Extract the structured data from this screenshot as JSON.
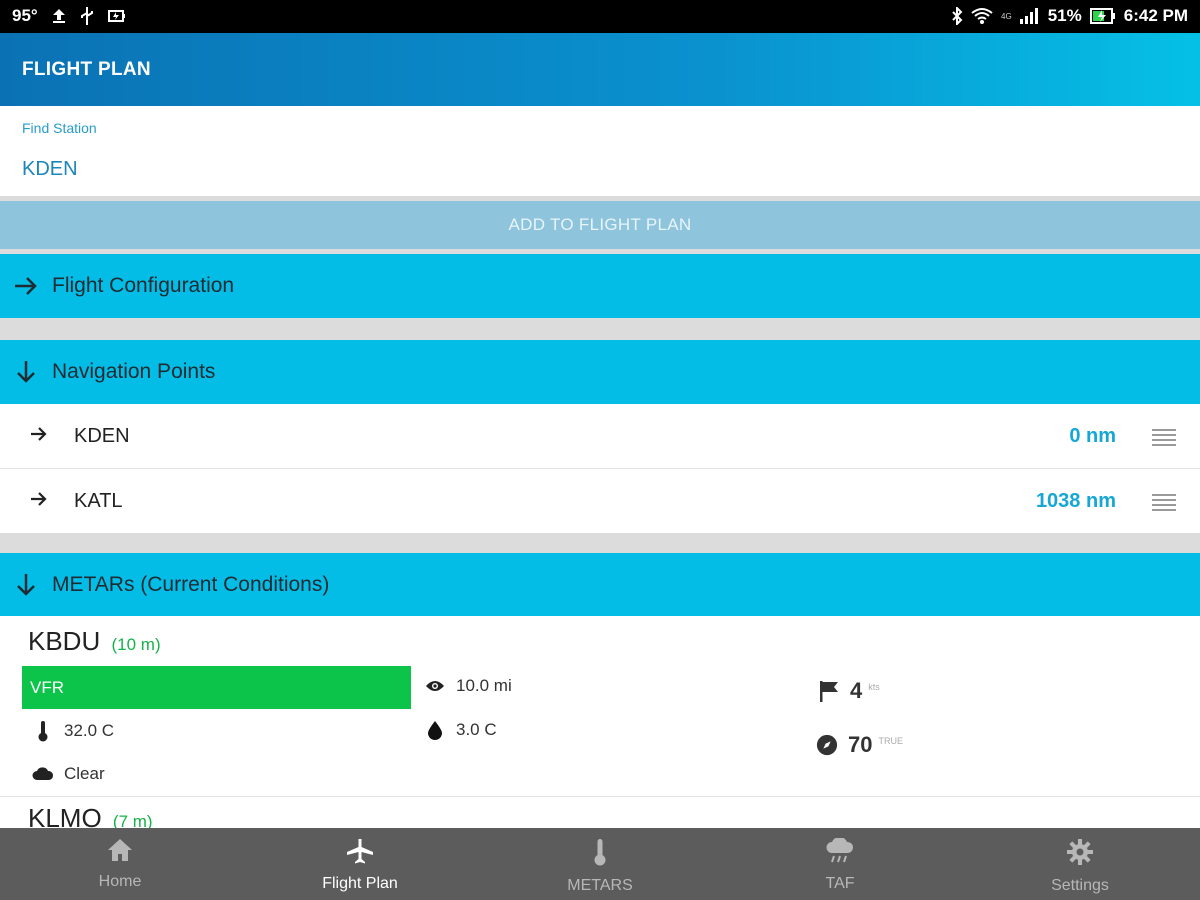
{
  "status_bar": {
    "temperature": "95°",
    "network_tag": "4G",
    "battery": "51%",
    "time": "6:42 PM"
  },
  "header": {
    "title": "FLIGHT PLAN"
  },
  "find_station": {
    "label": "Find Station",
    "value": "KDEN"
  },
  "add_button_label": "ADD TO FLIGHT PLAN",
  "sections": {
    "flight_config": "Flight Configuration",
    "nav_points": "Navigation Points",
    "metars": "METARs (Current Conditions)"
  },
  "navigation_points": [
    {
      "code": "KDEN",
      "distance": "0 nm"
    },
    {
      "code": "KATL",
      "distance": "1038 nm"
    }
  ],
  "metars": [
    {
      "station": "KBDU",
      "distance": "(10 m)",
      "category": "VFR",
      "visibility": "10.0 mi",
      "temperature": "32.0 C",
      "dewpoint": "3.0 C",
      "sky": "Clear",
      "wind_speed": "4",
      "wind_speed_unit": "kts",
      "wind_direction": "70",
      "wind_direction_unit": "TRUE"
    },
    {
      "station": "KLMO",
      "distance": "(7 m)"
    }
  ],
  "bottom_nav": [
    {
      "label": "Home",
      "icon": "home-icon"
    },
    {
      "label": "Flight Plan",
      "icon": "airplane-icon",
      "active": true
    },
    {
      "label": "METARS",
      "icon": "thermometer-icon"
    },
    {
      "label": "TAF",
      "icon": "cloud-rain-icon"
    },
    {
      "label": "Settings",
      "icon": "gear-icon"
    }
  ],
  "colors": {
    "accent": "#03bde6",
    "header_start": "#0a72b4",
    "vfr_green": "#0cc44a",
    "distance_blue": "#16a7d6",
    "bottom_nav_bg": "#5c5c5c"
  }
}
